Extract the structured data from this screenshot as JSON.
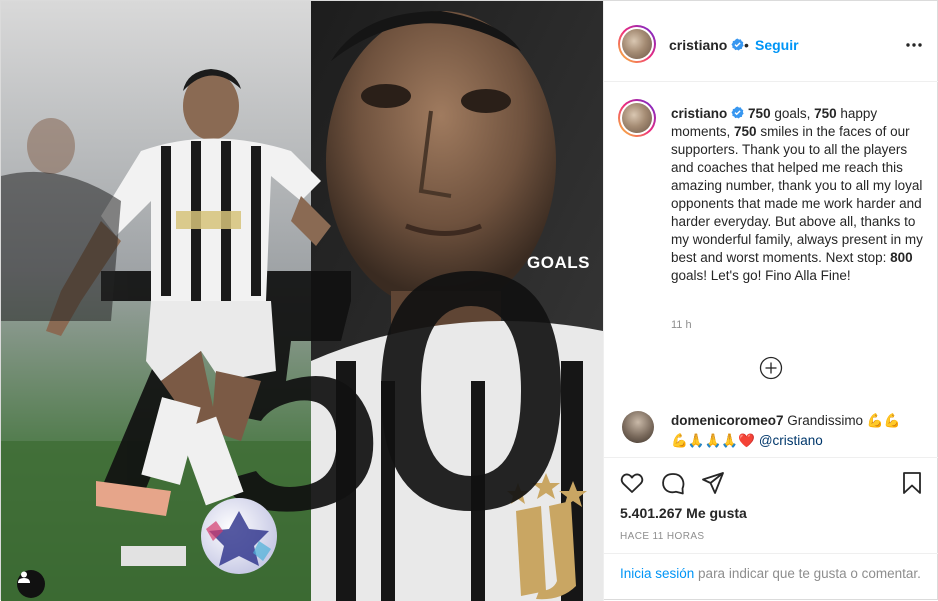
{
  "post": {
    "username": "cristiano",
    "separator": "•",
    "follow_label": "Seguir",
    "image_overlay_text": "GOALS",
    "big_number_text": "750"
  },
  "caption": {
    "username": "cristiano",
    "parts": [
      {
        "text": "750",
        "bold": true
      },
      {
        "text": " goals, ",
        "bold": false
      },
      {
        "text": "750",
        "bold": true
      },
      {
        "text": " happy moments, ",
        "bold": false
      },
      {
        "text": "750",
        "bold": true
      },
      {
        "text": " smiles in the faces of our supporters. Thank you to all the players and coaches that helped me reach this amazing number, thank you to all my loyal opponents that made me work harder and harder everyday. But above all, thanks to my wonderful family, always present in my best and worst moments. Next stop: ",
        "bold": false
      },
      {
        "text": "800",
        "bold": true
      },
      {
        "text": " goals! Let's go! Fino Alla Fine!",
        "bold": false
      }
    ],
    "time": "11 h"
  },
  "comment": {
    "username": "domenicoromeo7",
    "text": "Grandissimo",
    "emojis_1": "💪💪",
    "emojis_2": "💪🙏🙏🙏❤️",
    "mention": "@cristiano"
  },
  "actions": {
    "likes": "5.401.267 Me gusta",
    "ago": "HACE 11 HORAS"
  },
  "login": {
    "link": "Inicia sesión",
    "text": " para indicar que te gusta o comentar."
  },
  "colors": {
    "link_blue": "#0095f6",
    "verified_blue": "#3897f0",
    "mention_blue": "#00376b",
    "muted": "#8e8e8e"
  }
}
